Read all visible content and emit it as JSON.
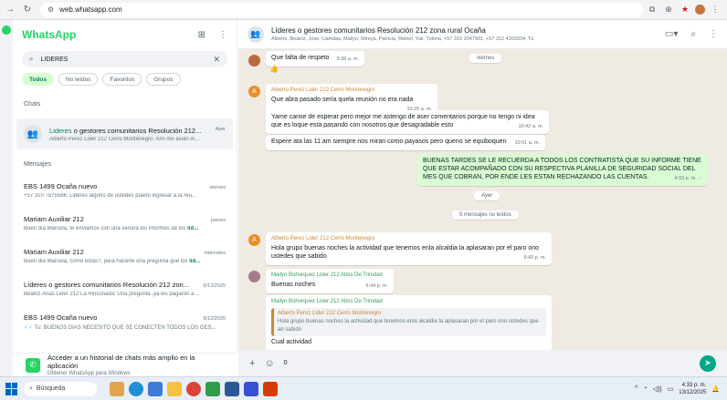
{
  "browser": {
    "url": "web.whatsapp.com"
  },
  "left": {
    "brand": "WhatsApp",
    "search_value": "LIDERES",
    "filters": [
      "Todos",
      "No leídos",
      "Favoritos",
      "Grupos"
    ],
    "section_chats": "Chats",
    "section_messages": "Mensajes",
    "group": {
      "title_hl": "Lideres",
      "title_rest": " o gestores comunitarios Resolución 212...",
      "time": "Ayer",
      "subtitle": "Alberto Perez Lider 212 Cerro Montenegro: Ami me avian in..."
    },
    "messages": [
      {
        "name": "EBS 1499 Ocaña nuevo",
        "date": "viernes",
        "preview": "+57 310 7875586: Lideres alguno de ustedes puedo ingresar a la reu...",
        "hl": ""
      },
      {
        "name": "Mariam Auxiliar 212",
        "date": "jueves",
        "preview": "Buen día Marcela, te enviamos con una señora los informes de los ",
        "hl": "líd..."
      },
      {
        "name": "Mariam Auxiliar 212",
        "date": "miércoles",
        "preview": "Buen día Marcela, como estas?, para hacerte una pregunta que los ",
        "hl": "líd..."
      },
      {
        "name": "Líderes o gestores comunitarios Resolución 212 zon...",
        "date": "6/12/2025",
        "preview": "Beatriz Arias Lider 212 La Rinconada: Una pregunta ,ya les pagaron a ...",
        "hl": ""
      },
      {
        "name": "EBS 1499 Ocaña nuevo",
        "date": "5/12/2025",
        "preview": "Tu: BUENOS DIAS NECESITO QUE SE CONECTEN TODOS LOS GES...",
        "hl": ""
      }
    ],
    "promo_title": "Acceder a un historial de chats más amplio en la aplicación",
    "promo_sub": "Obtener WhatsApp para Windows"
  },
  "right": {
    "title": "Líderes o gestores comunitarios Resolución 212 zona rural Ocaña",
    "members": "Alberto, Beatriz, Jose, Llamdas, Mailyn, Mireya, Patricia, Reinel, Yair, Yolima, +57 310 2047581, +57 312 4303934, Tú",
    "chat": {
      "m1_text": "Que falta de respeto",
      "m1_time": "9:38 a. m.",
      "m1_emoji": "👍",
      "day_viernes": "viernes",
      "m2_sender": "Alberto Perez Lider 212 Cerro Montenegro",
      "m2_text": "Que abra pasado sería quela reunión no era nada",
      "m2_time": "10:25 a. m.",
      "m3_text": "Yame canse de esperar pero mejor me astengo de aser comentarios porque no tengo ni idea que es loque esta pasando con nosotros que desagradable esto",
      "m3_time": "10:42 a. m.",
      "m4_text": "Espere ata las 11 am siempre nos miran como payasos pero queno se equiboquen",
      "m4_time": "10:51 a. m.",
      "out_text": "BUENAS TARDES  SE LE RECUERDA A TODOS LOS CONTRATISTA QUE SU INFORME TIENE QUE ESTAR ACOMPAÑADO CON SU RESPECTIVA PLANILLA DE SEGURIDAD SOCIAL DEL MES QUE COBRAN, POR ENDE LES ESTAN RECHAZANDO LAS CUENTAS.",
      "out_time": "4:03 p. m.",
      "day_ayer": "Ayer",
      "unread": "5 mensajes no leídos",
      "m5_sender": "Alberto Perez Lider 212 Cerro Montenegro",
      "m5_text": "Hola grupo buenas noches la actividad que tenemos enla alcaldia la aplasaran por el paro ono ustedes que sabido",
      "m5_time": "6:43 p. m.",
      "m6_sender": "Mailyn Bohorquez Lider 212 Altos De Trinidad",
      "m6_text": "Buenas noches",
      "m6_time": "6:44 p. m.",
      "m7_sender": "Mailyn Bohorquez Lider 212 Altos De Trinidad",
      "m7_quote_name": "Alberto Perez Lider 212 Cerro Montenegro",
      "m7_quote_text": "Hola grupo buenas noches la actividad que tenemos enla alcaldia la aplasaran por el paro ono ustedes que an sabido",
      "m7_text": "Cual actividad"
    },
    "composer_value": "0"
  },
  "taskbar": {
    "search": "Búsqueda",
    "time": "4:33 p. m.",
    "date": "13/12/2025"
  },
  "colors": {
    "brand": "#25d366",
    "teal": "#008069",
    "outgoing": "#d9fdd3",
    "chat_bg": "#efeae2"
  }
}
